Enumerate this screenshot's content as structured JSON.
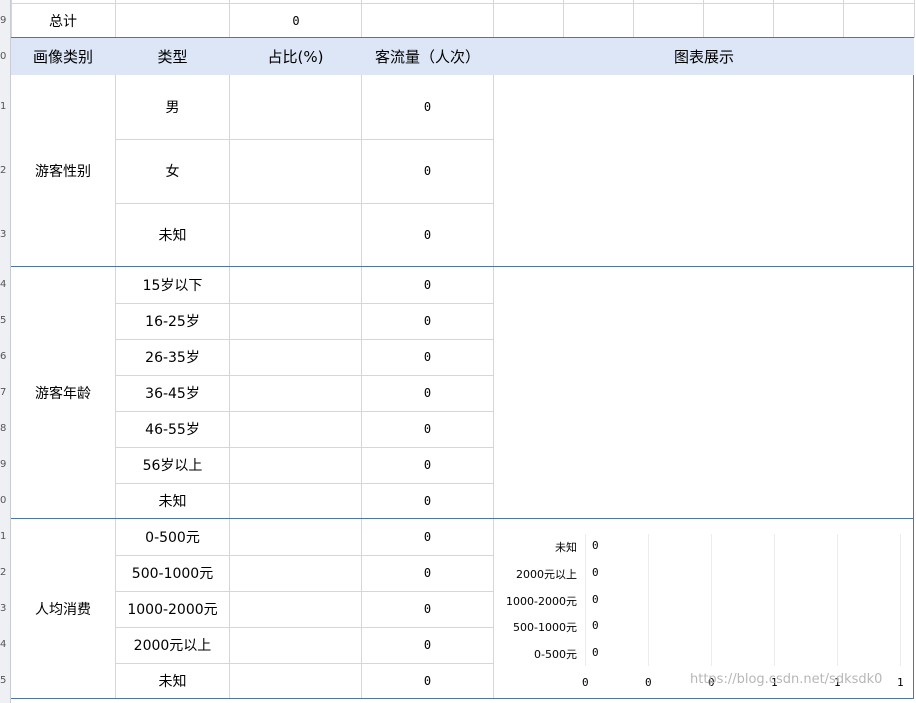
{
  "row_numbers": [
    "9",
    "0",
    "1",
    "2",
    "3",
    "4",
    "5",
    "6",
    "7",
    "8",
    "9",
    "0",
    "1",
    "2",
    "3",
    "4",
    "5"
  ],
  "total_row": {
    "label": "总计",
    "value": "0"
  },
  "headers": {
    "category": "画像类别",
    "type": "类型",
    "ratio": "占比(%)",
    "traffic": "客流量（人次）",
    "chart": "图表展示"
  },
  "groups": [
    {
      "name": "游客性别",
      "rows": [
        {
          "type": "男",
          "traffic": "0"
        },
        {
          "type": "女",
          "traffic": "0"
        },
        {
          "type": "未知",
          "traffic": "0"
        }
      ]
    },
    {
      "name": "游客年龄",
      "rows": [
        {
          "type": "15岁以下",
          "traffic": "0"
        },
        {
          "type": "16-25岁",
          "traffic": "0"
        },
        {
          "type": "26-35岁",
          "traffic": "0"
        },
        {
          "type": "36-45岁",
          "traffic": "0"
        },
        {
          "type": "46-55岁",
          "traffic": "0"
        },
        {
          "type": "56岁以上",
          "traffic": "0"
        },
        {
          "type": "未知",
          "traffic": "0"
        }
      ]
    },
    {
      "name": "人均消费",
      "rows": [
        {
          "type": "0-500元",
          "traffic": "0"
        },
        {
          "type": "500-1000元",
          "traffic": "0"
        },
        {
          "type": "1000-2000元",
          "traffic": "0"
        },
        {
          "type": "2000元以上",
          "traffic": "0"
        },
        {
          "type": "未知",
          "traffic": "0"
        }
      ]
    }
  ],
  "consumption_chart": {
    "categories": [
      "未知",
      "2000元以上",
      "1000-2000元",
      "500-1000元",
      "0-500元"
    ],
    "values": [
      "0",
      "0",
      "0",
      "0",
      "0"
    ],
    "axis_ticks": [
      "0",
      "0",
      "0",
      "1",
      "1",
      "1"
    ]
  },
  "watermark": "https://blog.csdn.net/sdksdk0"
}
